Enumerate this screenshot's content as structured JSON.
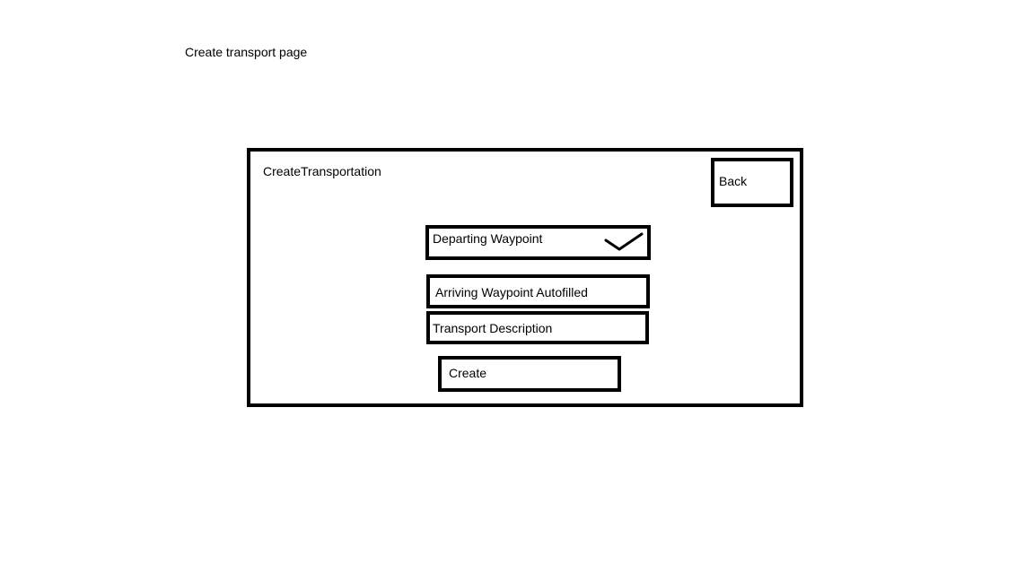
{
  "page": {
    "caption": "Create transport page"
  },
  "window": {
    "title": "CreateTransportation",
    "back_label": "Back"
  },
  "form": {
    "departing_label": "Departing Waypoint",
    "departing_status_icon": "check-icon",
    "arriving_label": "Arriving Waypoint Autofilled",
    "description_label": "Transport Description",
    "create_label": "Create"
  }
}
